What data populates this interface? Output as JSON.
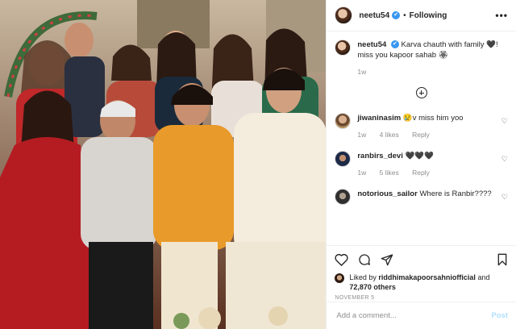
{
  "header": {
    "username": "neetu54",
    "verified_mark": "✔",
    "separator": "•",
    "follow_status": "Following",
    "more_label": "•••"
  },
  "caption": {
    "username": "neetu54",
    "text": "Karva chauth with family 🖤! miss you kapoor sahab 🏵",
    "age": "1w"
  },
  "comments": [
    {
      "username": "jiwaninasim",
      "text": "😢v miss him yoo",
      "age": "1w",
      "likes": "4 likes",
      "reply": "Reply"
    },
    {
      "username": "ranbirs_devi",
      "text": "🖤🖤🖤",
      "age": "1w",
      "likes": "5 likes",
      "reply": "Reply"
    },
    {
      "username": "notorious_sailor",
      "text": "Where is Ranbir????"
    }
  ],
  "likes": {
    "prefix": "Liked by",
    "user": "riddhimakapoorsahniofficial",
    "joiner": "and",
    "count": "72,870 others"
  },
  "date": "NOVEMBER 5",
  "comment_input": {
    "placeholder": "Add a comment...",
    "post_label": "Post"
  },
  "icons": [
    "heart-icon",
    "comment-icon",
    "share-icon",
    "bookmark-icon",
    "load-more-icon"
  ],
  "colors": {
    "link_blue": "#3897f0",
    "post_disabled": "#b2dffc",
    "muted": "#8e8e8e"
  }
}
